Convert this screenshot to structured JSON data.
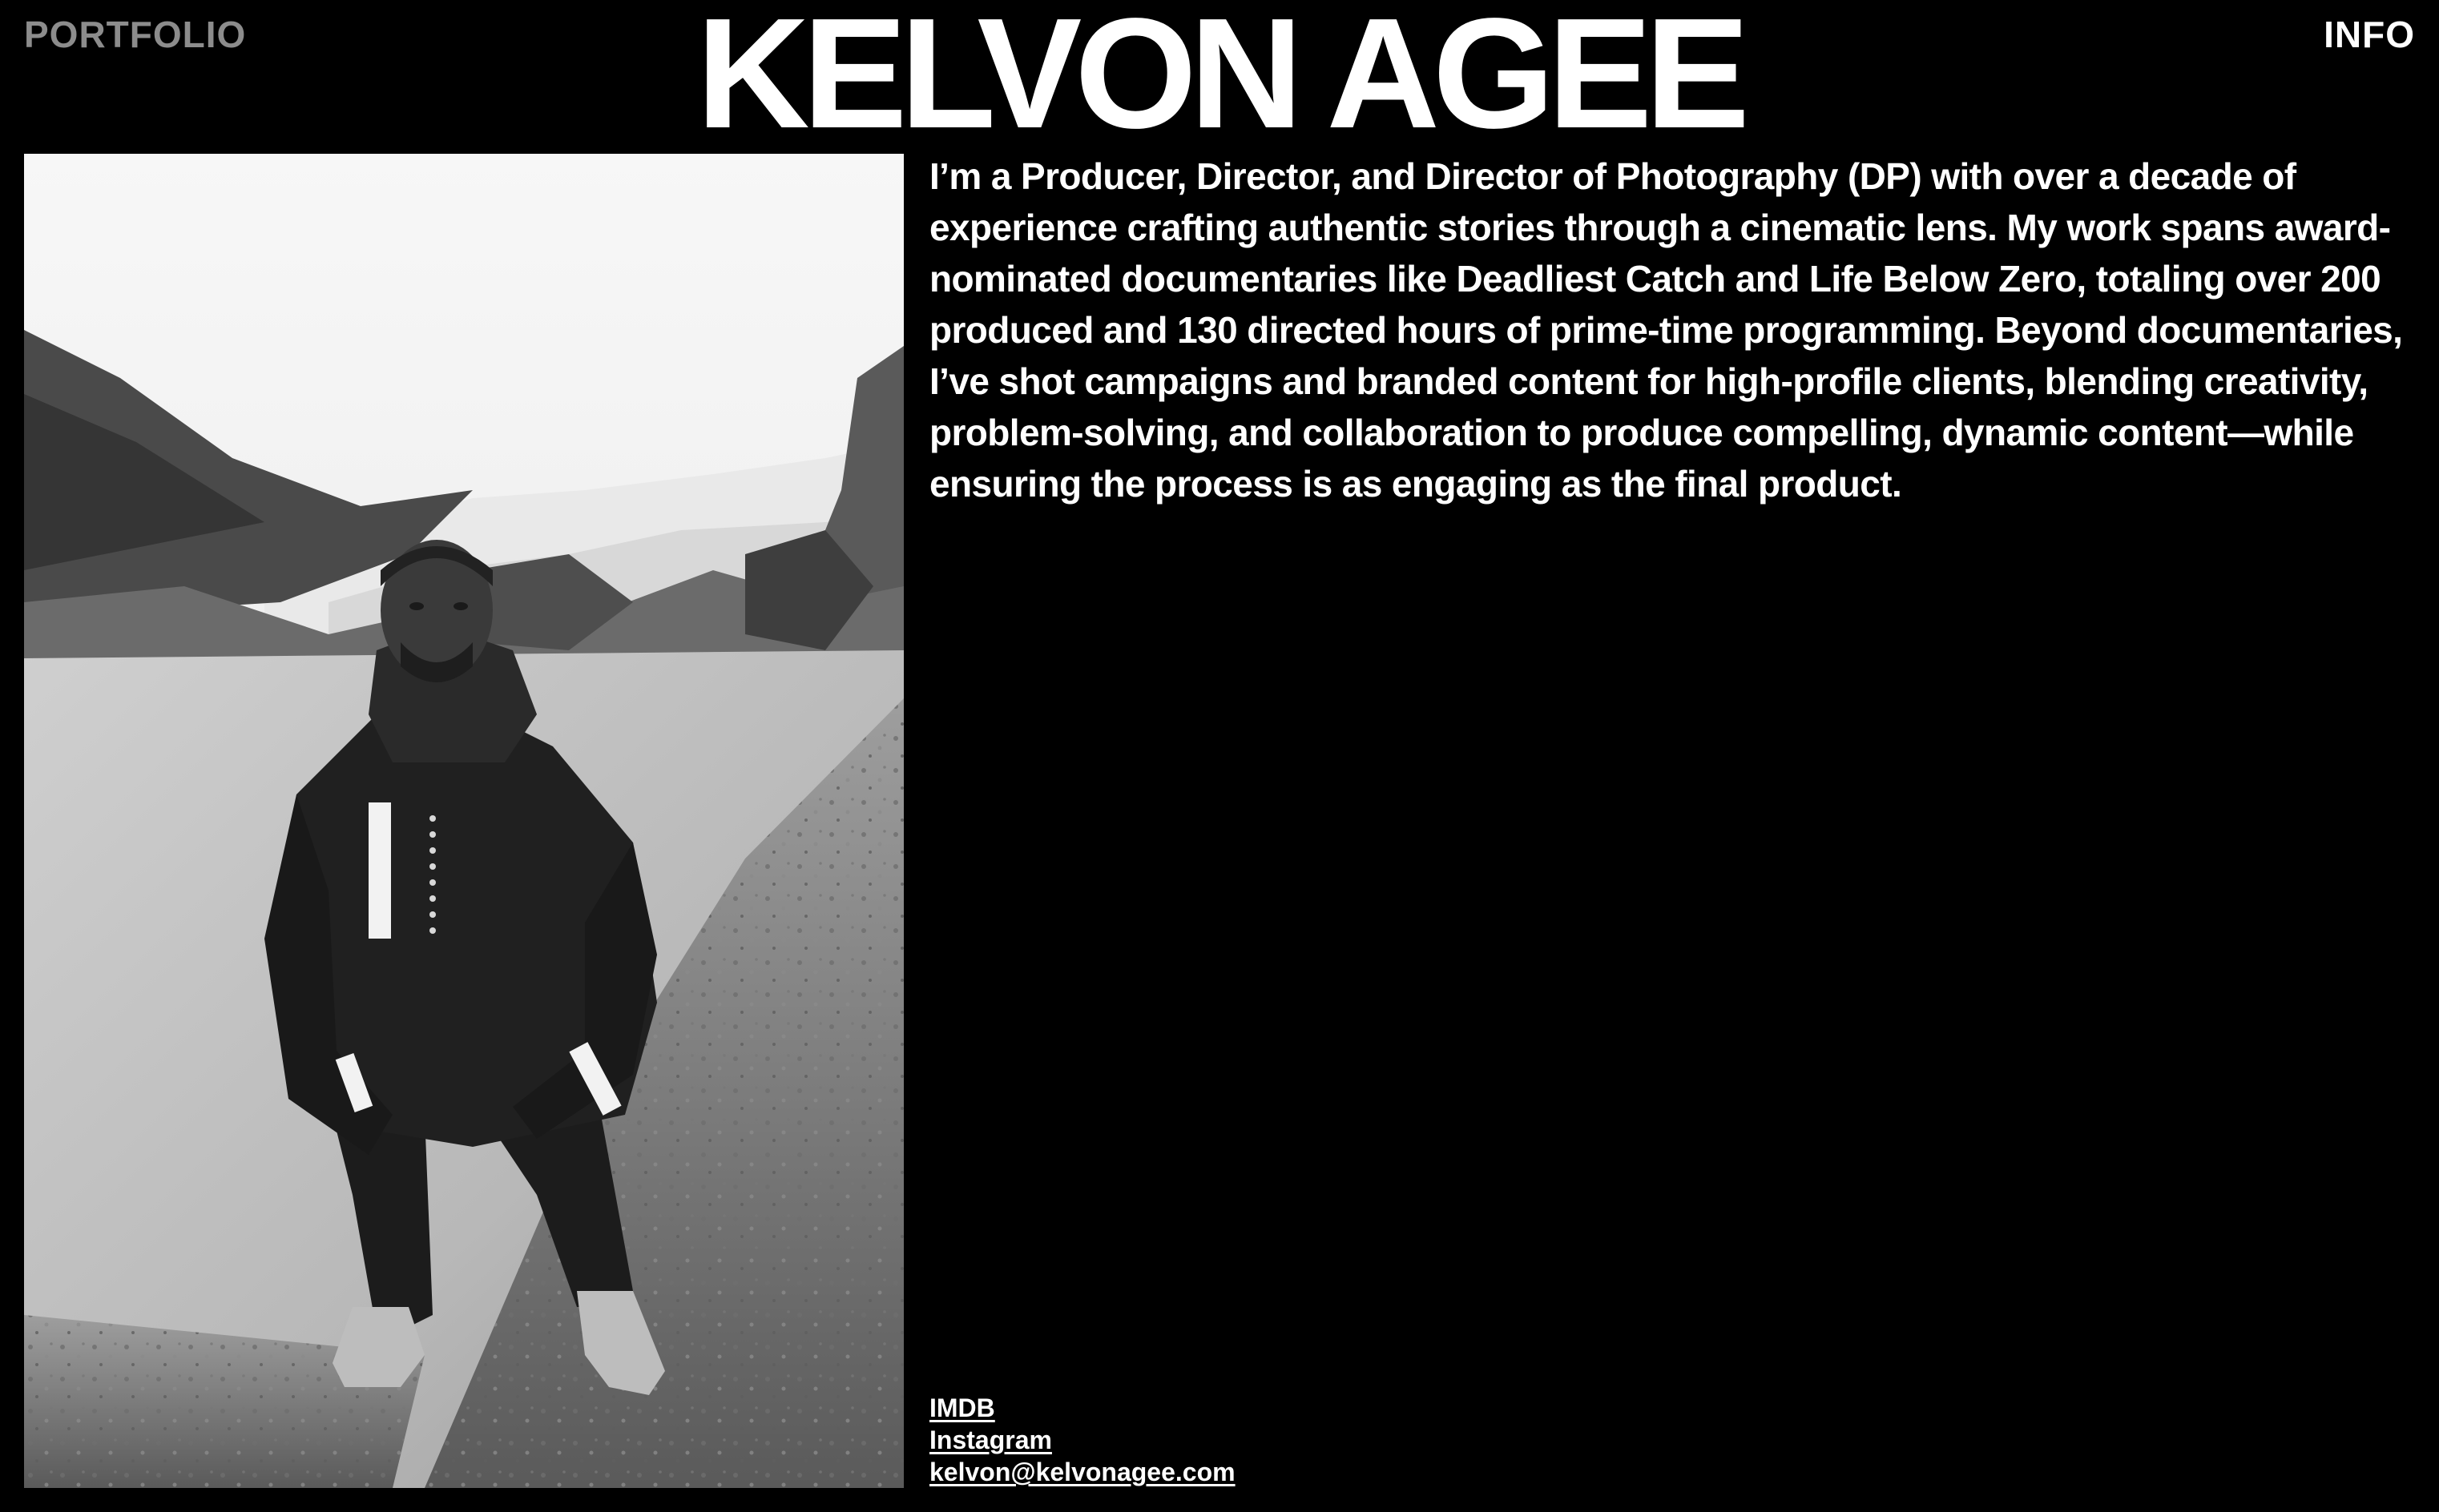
{
  "nav": {
    "left_label": "PORTFOLIO",
    "right_label": "INFO"
  },
  "header": {
    "title": "KELVON AGEE"
  },
  "bio": {
    "text": "I’m a Producer, Director, and Director of Photography (DP) with over a decade of experience crafting authentic stories through a cinematic lens. My work spans award-nominated documentaries like Deadliest Catch and Life Below Zero, totaling over 200 produced and 130 directed hours of prime-time programming. Beyond documentaries, I’ve shot campaigns and branded content for high-profile clients, blending creativity, problem-solving, and collaboration to produce compelling, dynamic content—while ensuring the process is as engaging as the final product."
  },
  "links": {
    "imdb": "IMDB",
    "instagram": "Instagram",
    "email": "kelvon@kelvonagee.com"
  },
  "colors": {
    "background": "#000000",
    "text": "#ffffff",
    "nav_muted": "#8c8c8c"
  }
}
